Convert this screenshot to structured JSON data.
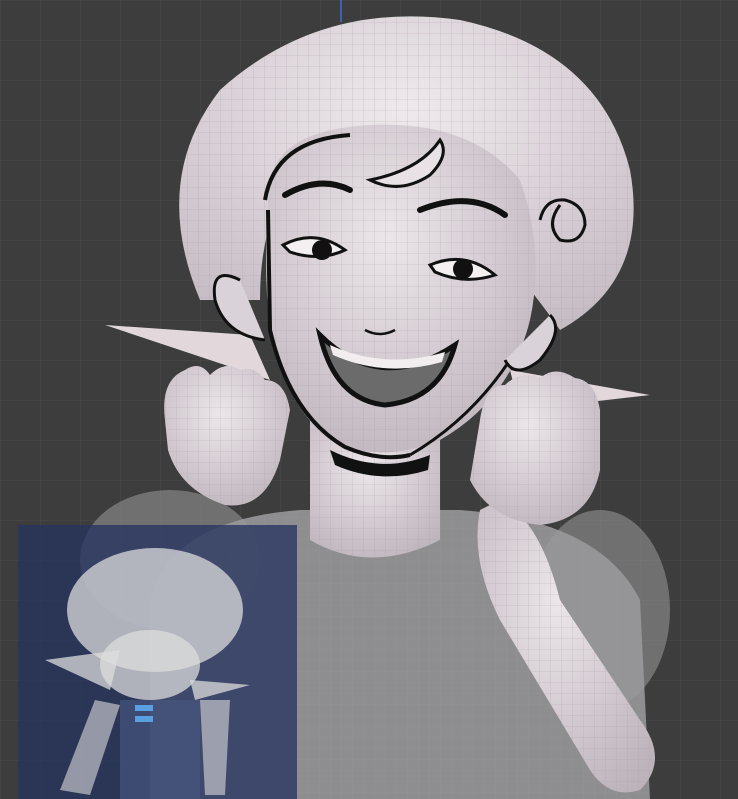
{
  "viewport": {
    "background_color": "#3d3d3d",
    "grid_color": "#4a4a4a",
    "axis_color": "#3f6fd8"
  },
  "model": {
    "skin_color": "#d9d2d8",
    "shirt_color": "#8e8e90",
    "wire_color": "#a79ea6",
    "ink_color": "#111111"
  },
  "reference_overlay": {
    "panel_color": "#27355f",
    "figure_color": "#dcdcdc"
  }
}
